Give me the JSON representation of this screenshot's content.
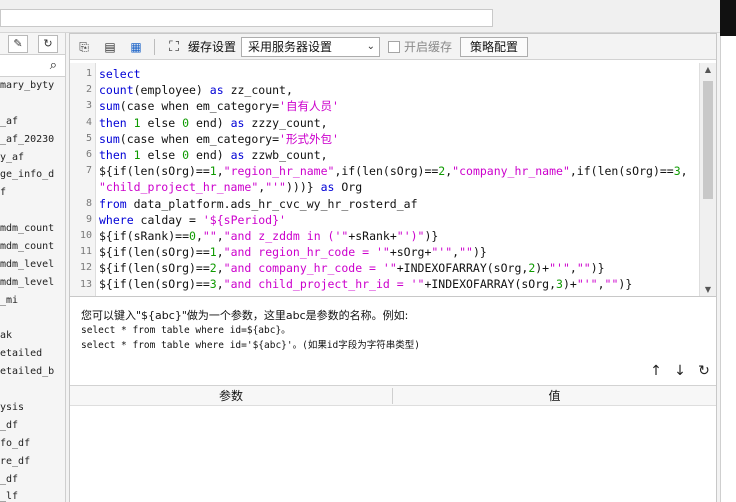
{
  "left_panel": {
    "toolbar_icons": [
      "edit-icon",
      "refresh-icon"
    ],
    "search_icon": "search-icon",
    "tree_items": [
      "mary_byty",
      "",
      "_af",
      "_af_20230",
      "y_af",
      "ge_info_d",
      "f",
      "",
      "mdm_count",
      "mdm_count",
      "mdm_level",
      "mdm_level",
      "_mi",
      "",
      "ak",
      "etailed",
      "etailed_b",
      "",
      "ysis",
      "_df",
      "fo_df",
      "re_df",
      "_df",
      "_lf"
    ]
  },
  "toolbar": {
    "cache_label": "缓存设置",
    "cache_select_value": "采用服务器设置",
    "enable_cache_label": "开启缓存",
    "strategy_button": "策略配置"
  },
  "editor": {
    "line_numbers": [
      "1",
      "2",
      "3",
      "4",
      "5",
      "6",
      "7",
      "",
      "8",
      "9",
      "10",
      "11",
      "12",
      "13",
      "14"
    ],
    "lines": [
      [
        {
          "t": "select",
          "c": "kw"
        }
      ],
      [
        {
          "t": "count",
          "c": "kw"
        },
        {
          "t": "(employee) ",
          "c": ""
        },
        {
          "t": "as",
          "c": "kw"
        },
        {
          "t": " zz_count,",
          "c": ""
        }
      ],
      [
        {
          "t": "sum",
          "c": "kw"
        },
        {
          "t": "(case when em_category=",
          "c": ""
        },
        {
          "t": "'自有人员'",
          "c": "str"
        }
      ],
      [
        {
          "t": "then",
          "c": "kw"
        },
        {
          "t": " ",
          "c": ""
        },
        {
          "t": "1",
          "c": "num"
        },
        {
          "t": " else ",
          "c": ""
        },
        {
          "t": "0",
          "c": "num"
        },
        {
          "t": " end) ",
          "c": ""
        },
        {
          "t": "as",
          "c": "kw"
        },
        {
          "t": " zzzy_count,",
          "c": ""
        }
      ],
      [
        {
          "t": "sum",
          "c": "kw"
        },
        {
          "t": "(case when em_category=",
          "c": ""
        },
        {
          "t": "'形式外包'",
          "c": "str"
        }
      ],
      [
        {
          "t": "then",
          "c": "kw"
        },
        {
          "t": " ",
          "c": ""
        },
        {
          "t": "1",
          "c": "num"
        },
        {
          "t": " else ",
          "c": ""
        },
        {
          "t": "0",
          "c": "num"
        },
        {
          "t": " end) ",
          "c": ""
        },
        {
          "t": "as",
          "c": "kw"
        },
        {
          "t": " zzwb_count,",
          "c": ""
        }
      ],
      [
        {
          "t": "${if(len(sOrg)==",
          "c": ""
        },
        {
          "t": "1",
          "c": "num"
        },
        {
          "t": ",",
          "c": ""
        },
        {
          "t": "\"region_hr_name\"",
          "c": "str"
        },
        {
          "t": ",if(len(sOrg)==",
          "c": ""
        },
        {
          "t": "2",
          "c": "num"
        },
        {
          "t": ",",
          "c": ""
        },
        {
          "t": "\"company_hr_name\"",
          "c": "str"
        },
        {
          "t": ",if(len(sOrg)==",
          "c": ""
        },
        {
          "t": "3",
          "c": "num"
        },
        {
          "t": ",",
          "c": ""
        }
      ],
      [
        {
          "t": "\"child_project_hr_name\"",
          "c": "str"
        },
        {
          "t": ",",
          "c": ""
        },
        {
          "t": "\"'\"",
          "c": "str"
        },
        {
          "t": ")))} ",
          "c": ""
        },
        {
          "t": "as",
          "c": "kw"
        },
        {
          "t": " Org",
          "c": ""
        }
      ],
      [
        {
          "t": "from",
          "c": "kw"
        },
        {
          "t": " data_platform.ads_hr_cvc_wy_hr_rosterd_af",
          "c": ""
        }
      ],
      [
        {
          "t": "where",
          "c": "kw"
        },
        {
          "t": " calday = ",
          "c": ""
        },
        {
          "t": "'${sPeriod}'",
          "c": "str"
        }
      ],
      [
        {
          "t": "${if(sRank)==",
          "c": ""
        },
        {
          "t": "0",
          "c": "num"
        },
        {
          "t": ",",
          "c": ""
        },
        {
          "t": "\"\"",
          "c": "str"
        },
        {
          "t": ",",
          "c": ""
        },
        {
          "t": "\"and z_zddm in ('\"",
          "c": "str"
        },
        {
          "t": "+sRank+",
          "c": ""
        },
        {
          "t": "\"')\"",
          "c": "str"
        },
        {
          "t": ")}",
          "c": ""
        }
      ],
      [
        {
          "t": "${if(len(sOrg)==",
          "c": ""
        },
        {
          "t": "1",
          "c": "num"
        },
        {
          "t": ",",
          "c": ""
        },
        {
          "t": "\"and region_hr_code = '\"",
          "c": "str"
        },
        {
          "t": "+sOrg+",
          "c": ""
        },
        {
          "t": "\"'\"",
          "c": "str"
        },
        {
          "t": ",",
          "c": ""
        },
        {
          "t": "\"\"",
          "c": "str"
        },
        {
          "t": ")}",
          "c": ""
        }
      ],
      [
        {
          "t": "${if(len(sOrg)==",
          "c": ""
        },
        {
          "t": "2",
          "c": "num"
        },
        {
          "t": ",",
          "c": ""
        },
        {
          "t": "\"and company_hr_code = '\"",
          "c": "str"
        },
        {
          "t": "+INDEXOFARRAY(sOrg,",
          "c": ""
        },
        {
          "t": "2",
          "c": "num"
        },
        {
          "t": ")+",
          "c": ""
        },
        {
          "t": "\"'\"",
          "c": "str"
        },
        {
          "t": ",",
          "c": ""
        },
        {
          "t": "\"\"",
          "c": "str"
        },
        {
          "t": ")}",
          "c": ""
        }
      ],
      [
        {
          "t": "${if(len(sOrg)==",
          "c": ""
        },
        {
          "t": "3",
          "c": "num"
        },
        {
          "t": ",",
          "c": ""
        },
        {
          "t": "\"and child_project_hr_id = '\"",
          "c": "str"
        },
        {
          "t": "+INDEXOFARRAY(sOrg,",
          "c": ""
        },
        {
          "t": "3",
          "c": "num"
        },
        {
          "t": ")+",
          "c": ""
        },
        {
          "t": "\"'\"",
          "c": "str"
        },
        {
          "t": ",",
          "c": ""
        },
        {
          "t": "\"\"",
          "c": "str"
        },
        {
          "t": ")}",
          "c": ""
        }
      ]
    ]
  },
  "hint": {
    "line1": "您可以键入\"${abc}\"做为一个参数，这里abc是参数的名称。例如:",
    "line2": "select * from table where id=${abc}。",
    "line3": "select * from table where id='${abc}'。(如果id字段为字符串类型)"
  },
  "params": {
    "col_param": "参数",
    "col_value": "值"
  },
  "colors": {
    "keyword": "#0000d6",
    "string": "#cc00cc",
    "number": "#0e9a00"
  }
}
